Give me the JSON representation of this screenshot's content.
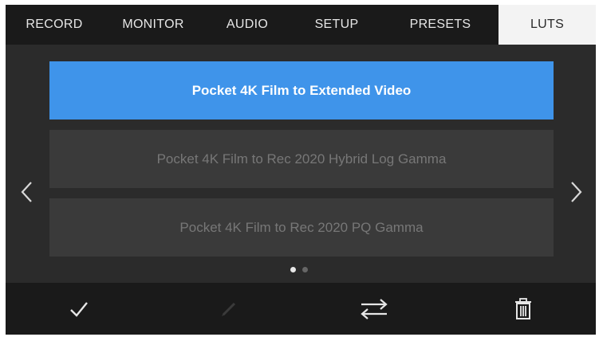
{
  "tabs": [
    {
      "label": "RECORD"
    },
    {
      "label": "MONITOR"
    },
    {
      "label": "AUDIO"
    },
    {
      "label": "SETUP"
    },
    {
      "label": "PRESETS"
    },
    {
      "label": "LUTS"
    }
  ],
  "active_tab": "LUTS",
  "luts": [
    {
      "label": "Pocket 4K Film to Extended Video",
      "selected": true
    },
    {
      "label": "Pocket 4K Film to Rec 2020 Hybrid Log Gamma",
      "selected": false
    },
    {
      "label": "Pocket 4K Film to Rec 2020 PQ Gamma",
      "selected": false
    }
  ],
  "pagination": {
    "pages": 2,
    "current": 1
  },
  "toolbar": {
    "icons": [
      "check-icon",
      "pencil-icon",
      "swap-arrows-icon",
      "trash-icon"
    ]
  },
  "colors": {
    "selected_item": "#3f94ea",
    "item_background": "#3a3a3a",
    "screen_background": "#2b2b2b",
    "bar_background": "#1a1a1a",
    "active_tab_background": "#f3f3f3"
  }
}
